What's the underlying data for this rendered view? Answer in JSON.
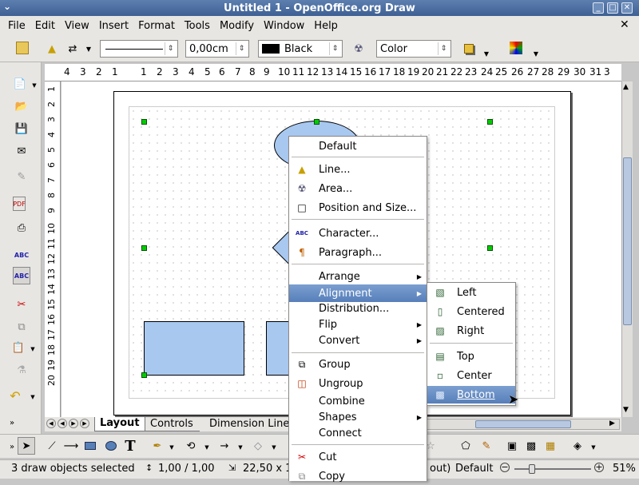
{
  "window": {
    "title": "Untitled 1 - OpenOffice.org Draw"
  },
  "menubar": [
    "File",
    "Edit",
    "View",
    "Insert",
    "Format",
    "Tools",
    "Modify",
    "Window",
    "Help"
  ],
  "toolbar": {
    "line_width": "0,00cm",
    "line_color": "Black",
    "area_style": "Color"
  },
  "hruler_labels": [
    "4",
    "3",
    "2",
    "1",
    "1",
    "2",
    "3",
    "4",
    "5",
    "6",
    "7",
    "8",
    "9",
    "10",
    "11",
    "12",
    "13",
    "14",
    "15",
    "16",
    "17",
    "18",
    "19",
    "20",
    "21",
    "22",
    "23",
    "24",
    "25",
    "26",
    "27",
    "28",
    "29",
    "30",
    "31",
    "3"
  ],
  "vruler_labels": [
    "1",
    "2",
    "3",
    "4",
    "5",
    "6",
    "7",
    "8",
    "9",
    "10",
    "11",
    "12",
    "13",
    "14",
    "15",
    "16",
    "17",
    "18",
    "19",
    "20"
  ],
  "tabs": [
    "Layout",
    "Controls",
    "Dimension Lines"
  ],
  "context_menu": {
    "default": "Default",
    "line": "Line...",
    "area": "Area...",
    "position_size": "Position and Size...",
    "character": "Character...",
    "paragraph": "Paragraph...",
    "arrange": "Arrange",
    "alignment": "Alignment",
    "distribution": "Distribution...",
    "flip": "Flip",
    "convert": "Convert",
    "group": "Group",
    "ungroup": "Ungroup",
    "combine": "Combine",
    "shapes": "Shapes",
    "connect": "Connect",
    "cut": "Cut",
    "copy": "Copy"
  },
  "alignment_menu": {
    "left": "Left",
    "centered": "Centered",
    "right": "Right",
    "top": "Top",
    "center": "Center",
    "bottom": "Bottom"
  },
  "status": {
    "selection": "3 draw objects selected",
    "position": "1,00 / 1,00",
    "size": "22,50 x 1",
    "mode_tail": "out)",
    "page_style": "Default",
    "zoom": "51%"
  },
  "colors": {
    "shape_fill": "#a8c8f0",
    "highlight": "#6890c8",
    "title_bg": "#4a6ca0"
  }
}
